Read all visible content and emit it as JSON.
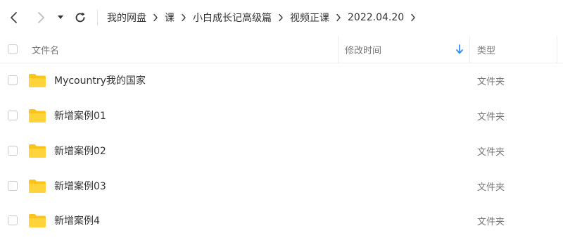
{
  "toolbar": {
    "back_icon": "chevron-left-icon",
    "forward_icon": "chevron-right-icon",
    "dropdown_icon": "caret-down-icon",
    "refresh_icon": "refresh-icon"
  },
  "breadcrumb": [
    {
      "label": "我的网盘"
    },
    {
      "label": "课"
    },
    {
      "label": "小白成长记高级篇"
    },
    {
      "label": "视频正课"
    },
    {
      "label": "2022.04.20"
    }
  ],
  "columns": {
    "name": "文件名",
    "modified": "修改时间",
    "type": "类型",
    "sort_icon": "sort-down-arrow-icon"
  },
  "files": [
    {
      "name": "Mycountry我的国家",
      "type": "文件夹",
      "icon": "folder-icon"
    },
    {
      "name": "新增案例01",
      "type": "文件夹",
      "icon": "folder-icon"
    },
    {
      "name": "新增案例02",
      "type": "文件夹",
      "icon": "folder-icon"
    },
    {
      "name": "新增案例03",
      "type": "文件夹",
      "icon": "folder-icon"
    },
    {
      "name": "新增案例4",
      "type": "文件夹",
      "icon": "folder-icon"
    }
  ],
  "colors": {
    "folder": "#fcc419",
    "sort_arrow": "#2f8cff",
    "text": "#333333",
    "muted": "#777777"
  }
}
